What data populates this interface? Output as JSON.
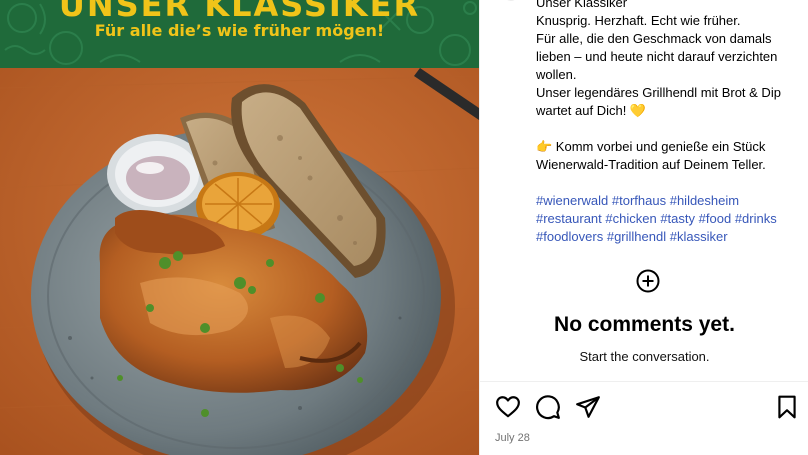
{
  "banner": {
    "title": "UNSER KLASSIKER",
    "subtitle": "Für alle die’s wie früher mögen!"
  },
  "caption": {
    "lines": [
      "Unser Klassiker",
      "Knusprig. Herzhaft. Echt wie früher.",
      "Für alle, die den Geschmack von damals",
      "lieben – und heute nicht darauf verzichten",
      "wollen.",
      "Unser legendäres Grillhendl mit Brot & Dip",
      "wartet auf Dich! 💛",
      "",
      "👉 Komm vorbei und genieße ein Stück",
      "Wienerwald-Tradition auf Deinem Teller."
    ],
    "hashtags": [
      "#wienerwald",
      "#torfhaus",
      "#hildesheim",
      "#restaurant",
      "#chicken",
      "#tasty",
      "#food",
      "#drinks",
      "#foodlovers",
      "#grillhendl",
      "#klassiker"
    ]
  },
  "comments": {
    "empty_title": "No comments yet.",
    "empty_subtitle": "Start the conversation."
  },
  "actions": {
    "icons": [
      "heart-icon",
      "comment-icon",
      "share-icon",
      "bookmark-icon"
    ]
  },
  "post": {
    "date": "July 28"
  },
  "colors": {
    "banner_green": "#1f6a3a",
    "banner_text": "#f0c419",
    "hashtag": "#3757b9",
    "table_orange": "#c0662a"
  }
}
